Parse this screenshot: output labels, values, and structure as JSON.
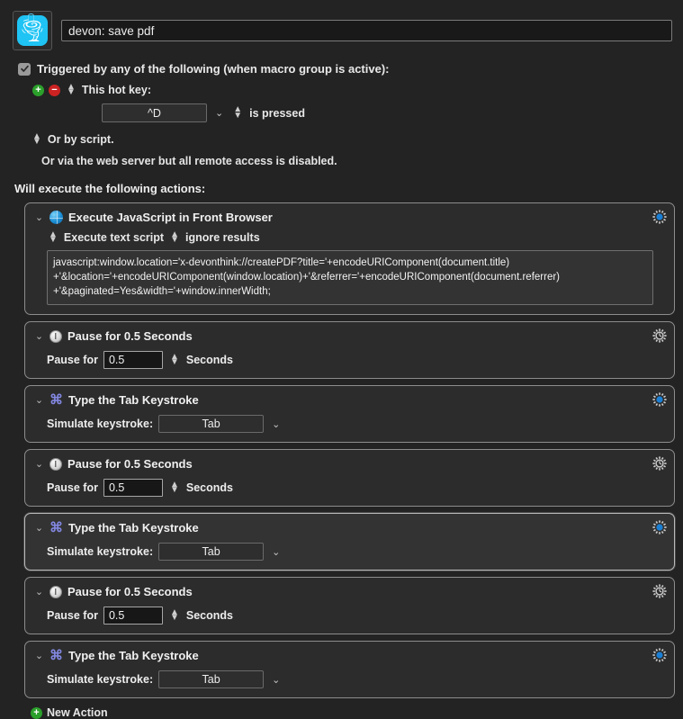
{
  "header": {
    "app_icon_name": "devonthink-shell-icon",
    "macro_title": "devon: save pdf"
  },
  "trigger": {
    "checkbox_checked": true,
    "label": "Triggered by any of the following (when macro group is active):",
    "add_button": "+",
    "remove_button": "−",
    "hot_key_label": "This hot key:",
    "hot_key_value": "^D",
    "condition_label": "is pressed",
    "script_label": "Or by script.",
    "web_server_label": "Or via the web server but all remote access is disabled."
  },
  "actions_header": "Will execute the following actions:",
  "actions": [
    {
      "title": "Execute JavaScript in Front Browser",
      "icon": "globe-icon",
      "gear": "gear-blue-icon",
      "selected": false,
      "type": "script",
      "option_1": "Execute text script",
      "option_2": "ignore results",
      "script": "javascript:window.location='x-devonthink://createPDF?title='+encodeURIComponent(document.title)\n+'&location='+encodeURIComponent(window.location)+'&referrer='+encodeURIComponent(document.referrer)\n+'&paginated=Yes&width='+window.innerWidth;"
    },
    {
      "title": "Pause for 0.5 Seconds",
      "icon": "clock-icon",
      "gear": "gear-clock-icon",
      "selected": false,
      "type": "pause",
      "field_label": "Pause for",
      "value": "0.5",
      "unit": "Seconds"
    },
    {
      "title": "Type the Tab Keystroke",
      "icon": "command-icon",
      "gear": "gear-blue-icon",
      "selected": false,
      "type": "keystroke",
      "field_label": "Simulate keystroke:",
      "value": "Tab"
    },
    {
      "title": "Pause for 0.5 Seconds",
      "icon": "clock-icon",
      "gear": "gear-clock-icon",
      "selected": false,
      "type": "pause",
      "field_label": "Pause for",
      "value": "0.5",
      "unit": "Seconds"
    },
    {
      "title": "Type the Tab Keystroke",
      "icon": "command-icon",
      "gear": "gear-blue-icon",
      "selected": true,
      "type": "keystroke",
      "field_label": "Simulate keystroke:",
      "value": "Tab"
    },
    {
      "title": "Pause for 0.5 Seconds",
      "icon": "clock-icon",
      "gear": "gear-clock-icon",
      "selected": false,
      "type": "pause",
      "field_label": "Pause for",
      "value": "0.5",
      "unit": "Seconds"
    },
    {
      "title": "Type the Tab Keystroke",
      "icon": "command-icon",
      "gear": "gear-blue-icon",
      "selected": false,
      "type": "keystroke",
      "field_label": "Simulate keystroke:",
      "value": "Tab"
    }
  ],
  "new_action": {
    "label": "New Action",
    "icon": "add-circle-icon"
  },
  "colors": {
    "background": "#232323",
    "action_bg": "#2c2c2c",
    "accent_blue": "#1b8fd6",
    "app_icon": "#1fc4f4",
    "add_green": "#2ba02b",
    "remove_red": "#cc2222",
    "command_purple": "#8287e0"
  }
}
